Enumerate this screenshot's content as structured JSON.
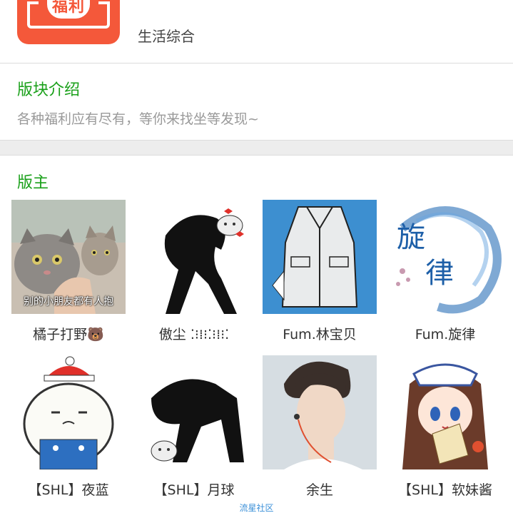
{
  "header": {
    "logo_text": "福利",
    "category": "生活综合"
  },
  "intro": {
    "title": "版块介绍",
    "text": "各种福利应有尽有，等你来找坐等发现~"
  },
  "moderators": {
    "title": "版主",
    "items": [
      {
        "name": "橘子打野🐻",
        "caption": "别的小朋友都有人抱"
      },
      {
        "name": "傲尘 ⁚⁝⁞⁝⁚⁝⁞⁝⁚"
      },
      {
        "name": "Fum.林宝贝"
      },
      {
        "name": "Fum.旋律",
        "art_text": [
          "旋",
          "律"
        ]
      },
      {
        "name": "【SHL】夜蓝"
      },
      {
        "name": "【SHL】月球"
      },
      {
        "name": "余生"
      },
      {
        "name": "【SHL】软妹酱"
      }
    ]
  },
  "watermark": "流星社区",
  "colors": {
    "accent_green": "#1aa01a",
    "logo_red": "#f4583a",
    "watermark_blue": "#3a8fd8"
  }
}
